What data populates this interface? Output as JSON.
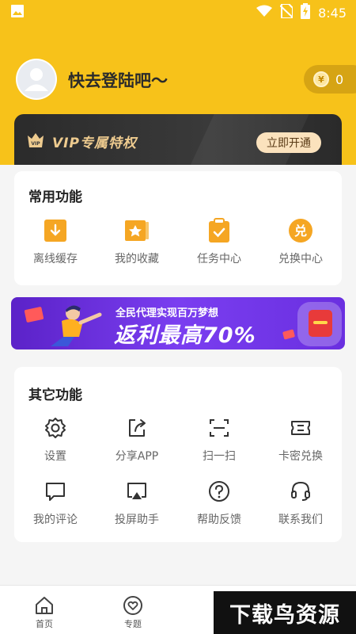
{
  "status_bar": {
    "time": "8:45"
  },
  "profile": {
    "login_prompt": "快去登陆吧～",
    "coins": "0",
    "coin_symbol": "¥"
  },
  "vip": {
    "title": "VIP专属特权",
    "badge_text": "VIP",
    "button": "立即开通"
  },
  "common_functions": {
    "title": "常用功能",
    "items": [
      {
        "label": "离线缓存",
        "icon": "download-icon"
      },
      {
        "label": "我的收藏",
        "icon": "star-folder-icon"
      },
      {
        "label": "任务中心",
        "icon": "clipboard-check-icon"
      },
      {
        "label": "兑换中心",
        "icon": "exchange-badge-icon",
        "glyph": "兑"
      }
    ]
  },
  "banner": {
    "subtitle": "全民代理实现百万梦想",
    "headline_prefix": "返利最高",
    "headline_value": "70%"
  },
  "other_functions": {
    "title": "其它功能",
    "items": [
      {
        "label": "设置",
        "icon": "gear-icon"
      },
      {
        "label": "分享APP",
        "icon": "share-icon"
      },
      {
        "label": "扫一扫",
        "icon": "scan-icon"
      },
      {
        "label": "卡密兑换",
        "icon": "ticket-icon"
      },
      {
        "label": "我的评论",
        "icon": "comment-icon"
      },
      {
        "label": "投屏助手",
        "icon": "cast-icon"
      },
      {
        "label": "帮助反馈",
        "icon": "help-icon"
      },
      {
        "label": "联系我们",
        "icon": "headset-icon"
      }
    ]
  },
  "tab_bar": {
    "items": [
      {
        "label": "首页",
        "icon": "home-icon"
      },
      {
        "label": "专题",
        "icon": "heart-icon"
      }
    ]
  },
  "watermark": "下载鸟资源",
  "colors": {
    "accent": "#f7c21a",
    "icon_orange": "#f5a623",
    "vip_gold": "#eecb8f",
    "banner_purple": "#6a2fe0"
  }
}
